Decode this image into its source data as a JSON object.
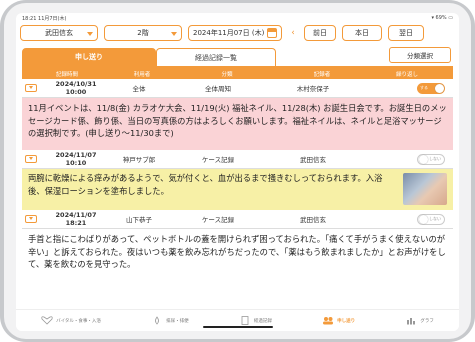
{
  "status": {
    "time": "18:21",
    "date": "11月7日(木)",
    "battery": "69%"
  },
  "header": {
    "staff": "武田信玄",
    "floor": "2階",
    "date": "2024年11月07日 (木)",
    "prev_label": "前日",
    "today_label": "本日",
    "next_label": "翌日"
  },
  "tabs": {
    "handover": "申し送り",
    "passed_records": "経過記録一覧",
    "classify_select": "分類選択"
  },
  "columns": {
    "datetime": "記録時間",
    "user": "利用者",
    "category": "分類",
    "recorder": "記録者",
    "repeat": "繰り返し"
  },
  "entries": [
    {
      "date": "2024/10/31",
      "time": "10:00",
      "user": "全体",
      "category": "全体周知",
      "recorder": "木村奈保子",
      "toggle": "する",
      "toggle_on": true,
      "color": "pink",
      "text": "11月イベントは、11/8(金) カラオケ大会、11/19(火) 福祉ネイル、11/28(木) お誕生日会です。お誕生日のメッセージカード係、飾り係、当日の写真係の方はよろしくお願いします。福祉ネイルは、ネイルと足浴マッサージの選択制です。(申し送り〜11/30まで)"
    },
    {
      "date": "2024/11/07",
      "time": "10:10",
      "user": "神戸サブ郎",
      "category": "ケース記録",
      "recorder": "武田信玄",
      "toggle": "しない",
      "toggle_on": false,
      "color": "yellow",
      "text": "両腕に乾燥による痒みがあるようで、気が付くと、血が出るまで掻きむしっておられます。入浴後、保湿ローションを塗布しました。"
    },
    {
      "date": "2024/11/07",
      "time": "18:21",
      "user": "山下恭子",
      "category": "ケース記録",
      "recorder": "武田信玄",
      "toggle": "しない",
      "toggle_on": false,
      "color": "white",
      "text": "手首と指にこわばりがあって、ペットボトルの蓋を開けられず困っておられた。「痛くて手がうまく使えないのが辛い」と訴えておられた。夜はいつも薬を飲み忘れがちだったので、「薬はもう飲まれましたか」とお声がけをして、薬を飲むのを見守った。"
    }
  ],
  "nav": {
    "vital": "バイタル・食事・入浴",
    "excretion": "排尿・排便",
    "passed": "経過記録",
    "handover": "申し送り",
    "graph": "グラフ"
  }
}
